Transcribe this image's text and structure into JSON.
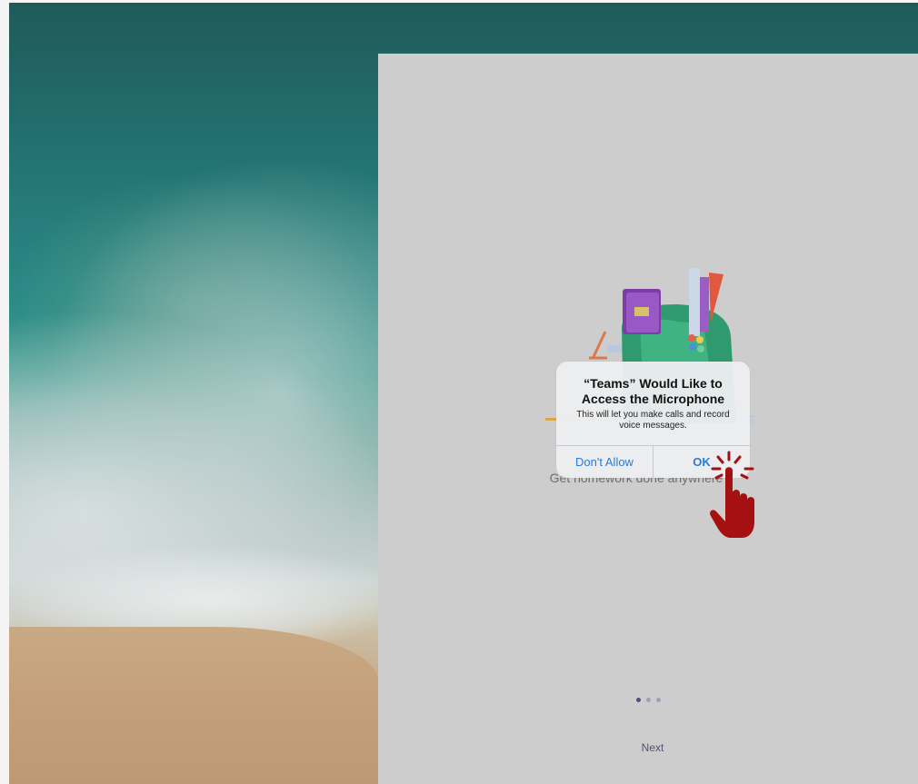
{
  "dialog": {
    "title": "“Teams” Would Like to Access the Microphone",
    "message": "This will let you make calls and record voice messages.",
    "deny_label": "Don't Allow",
    "allow_label": "OK"
  },
  "onboarding": {
    "subtitle": "Get homework done anywhere",
    "next_label": "Next",
    "page_dots": {
      "count": 3,
      "active_index": 0
    }
  },
  "colors": {
    "app_background": "#cdcdcd",
    "dialog_button": "#2a7ad6",
    "cursor_hand": "#a51010",
    "active_dot": "#4b4f8a"
  },
  "icons": {
    "cursor": "hand-pointer-icon",
    "illustration": "school-backpack-illustration"
  }
}
